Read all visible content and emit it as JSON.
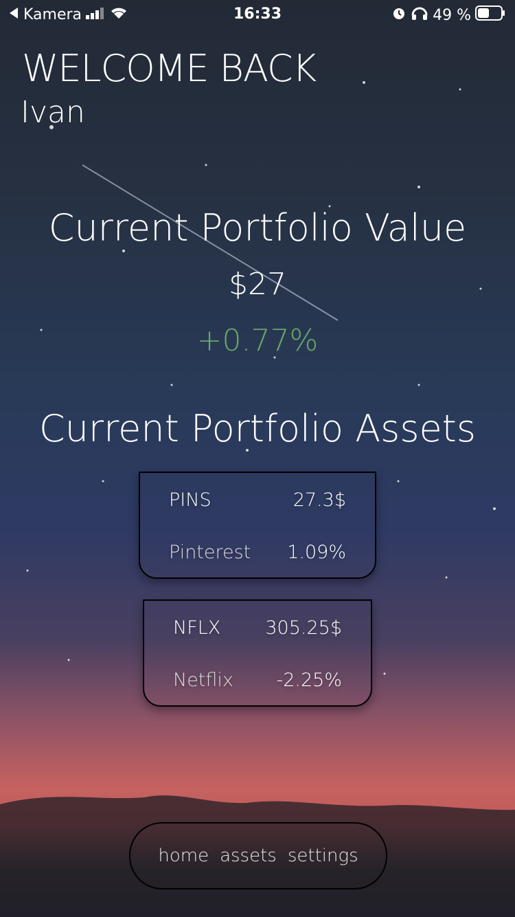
{
  "status": {
    "back_app": "Kamera",
    "time": "16:33",
    "battery": "49 %"
  },
  "welcome": {
    "title": "WELCOME BACK",
    "name": "Ivan"
  },
  "portfolio": {
    "value_title": "Current Portfolio Value",
    "value": "$27",
    "change": "+0.77%",
    "change_color": "#6aa76a",
    "assets_title": "Current Portfolio Assets"
  },
  "assets": [
    {
      "ticker": "PINS",
      "price": "27.3$",
      "name": "Pinterest",
      "change": "1.09%"
    },
    {
      "ticker": "NFLX",
      "price": "305.25$",
      "name": "Netflix",
      "change": "-2.25%"
    }
  ],
  "nav": {
    "home": "home",
    "assets": "assets",
    "settings": "settings"
  },
  "icons": [
    "back-arrow-icon",
    "signal-icon",
    "wifi-icon",
    "alarm-icon",
    "headphones-icon",
    "battery-icon"
  ]
}
